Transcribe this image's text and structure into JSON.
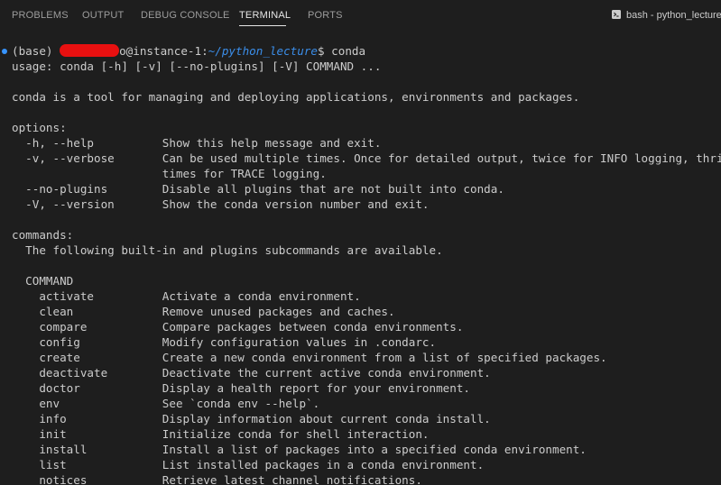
{
  "tabs": [
    {
      "label": "PROBLEMS",
      "active": false
    },
    {
      "label": "OUTPUT",
      "active": false
    },
    {
      "label": "DEBUG CONSOLE",
      "active": false
    },
    {
      "label": "TERMINAL",
      "active": true
    },
    {
      "label": "PORTS",
      "active": false
    }
  ],
  "shell": {
    "label": "bash - python_lecture",
    "icon": "terminal-icon"
  },
  "prompt": {
    "env": "(base) ",
    "user_fragment": "o",
    "host": "@instance-1:",
    "path": "~/python_lecture",
    "symbol": "$ ",
    "command": "conda"
  },
  "output": [
    "usage: conda [-h] [-v] [--no-plugins] [-V] COMMAND ...",
    "",
    "conda is a tool for managing and deploying applications, environments and packages.",
    "",
    "options:",
    "  -h, --help          Show this help message and exit.",
    "  -v, --verbose       Can be used multiple times. Once for detailed output, twice for INFO logging, thrice for DE",
    "                      times for TRACE logging.",
    "  --no-plugins        Disable all plugins that are not built into conda.",
    "  -V, --version       Show the conda version number and exit.",
    "",
    "commands:",
    "  The following built-in and plugins subcommands are available.",
    "",
    "  COMMAND",
    "    activate          Activate a conda environment.",
    "    clean             Remove unused packages and caches.",
    "    compare           Compare packages between conda environments.",
    "    config            Modify configuration values in .condarc.",
    "    create            Create a new conda environment from a list of specified packages.",
    "    deactivate        Deactivate the current active conda environment.",
    "    doctor            Display a health report for your environment.",
    "    env               See `conda env --help`.",
    "    info              Display information about current conda install.",
    "    init              Initialize conda for shell interaction.",
    "    install           Install a list of packages into a specified conda environment.",
    "    list              List installed packages in a conda environment.",
    "    notices           Retrieve latest channel notifications."
  ],
  "colors": {
    "background": "#1e1e1e",
    "text": "#cccccc",
    "path": "#3b8eea",
    "redaction": "#e81010",
    "decoration_dot": "#3794ff"
  }
}
